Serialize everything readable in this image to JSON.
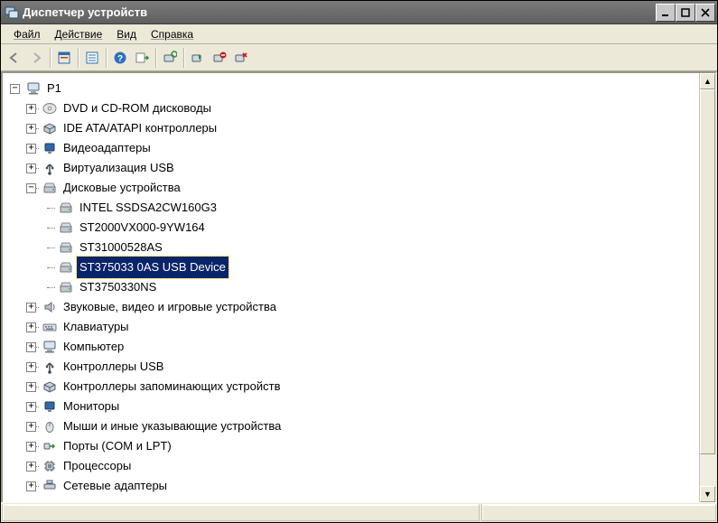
{
  "title": "Диспетчер устройств",
  "menu": {
    "file": "Файл",
    "action": "Действие",
    "view": "Вид",
    "help": "Справка"
  },
  "tree": {
    "root": "P1",
    "categories": [
      {
        "label": "DVD и CD-ROM дисководы",
        "expanded": false
      },
      {
        "label": "IDE ATA/ATAPI контроллеры",
        "expanded": false
      },
      {
        "label": "Видеоадаптеры",
        "expanded": false
      },
      {
        "label": "Виртуализация USB",
        "expanded": false
      },
      {
        "label": "Дисковые устройства",
        "expanded": true,
        "children": [
          "INTEL SSDSA2CW160G3",
          "ST2000VX000-9YW164",
          "ST31000528AS",
          "ST375033 0AS USB Device",
          "ST3750330NS"
        ],
        "selectedIndex": 3
      },
      {
        "label": "Звуковые, видео и игровые устройства",
        "expanded": false
      },
      {
        "label": "Клавиатуры",
        "expanded": false
      },
      {
        "label": "Компьютер",
        "expanded": false
      },
      {
        "label": "Контроллеры USB",
        "expanded": false
      },
      {
        "label": "Контроллеры запоминающих устройств",
        "expanded": false
      },
      {
        "label": "Мониторы",
        "expanded": false
      },
      {
        "label": "Мыши и иные указывающие устройства",
        "expanded": false
      },
      {
        "label": "Порты (COM и LPT)",
        "expanded": false
      },
      {
        "label": "Процессоры",
        "expanded": false
      },
      {
        "label": "Сетевые адаптеры",
        "expanded": false
      }
    ]
  }
}
